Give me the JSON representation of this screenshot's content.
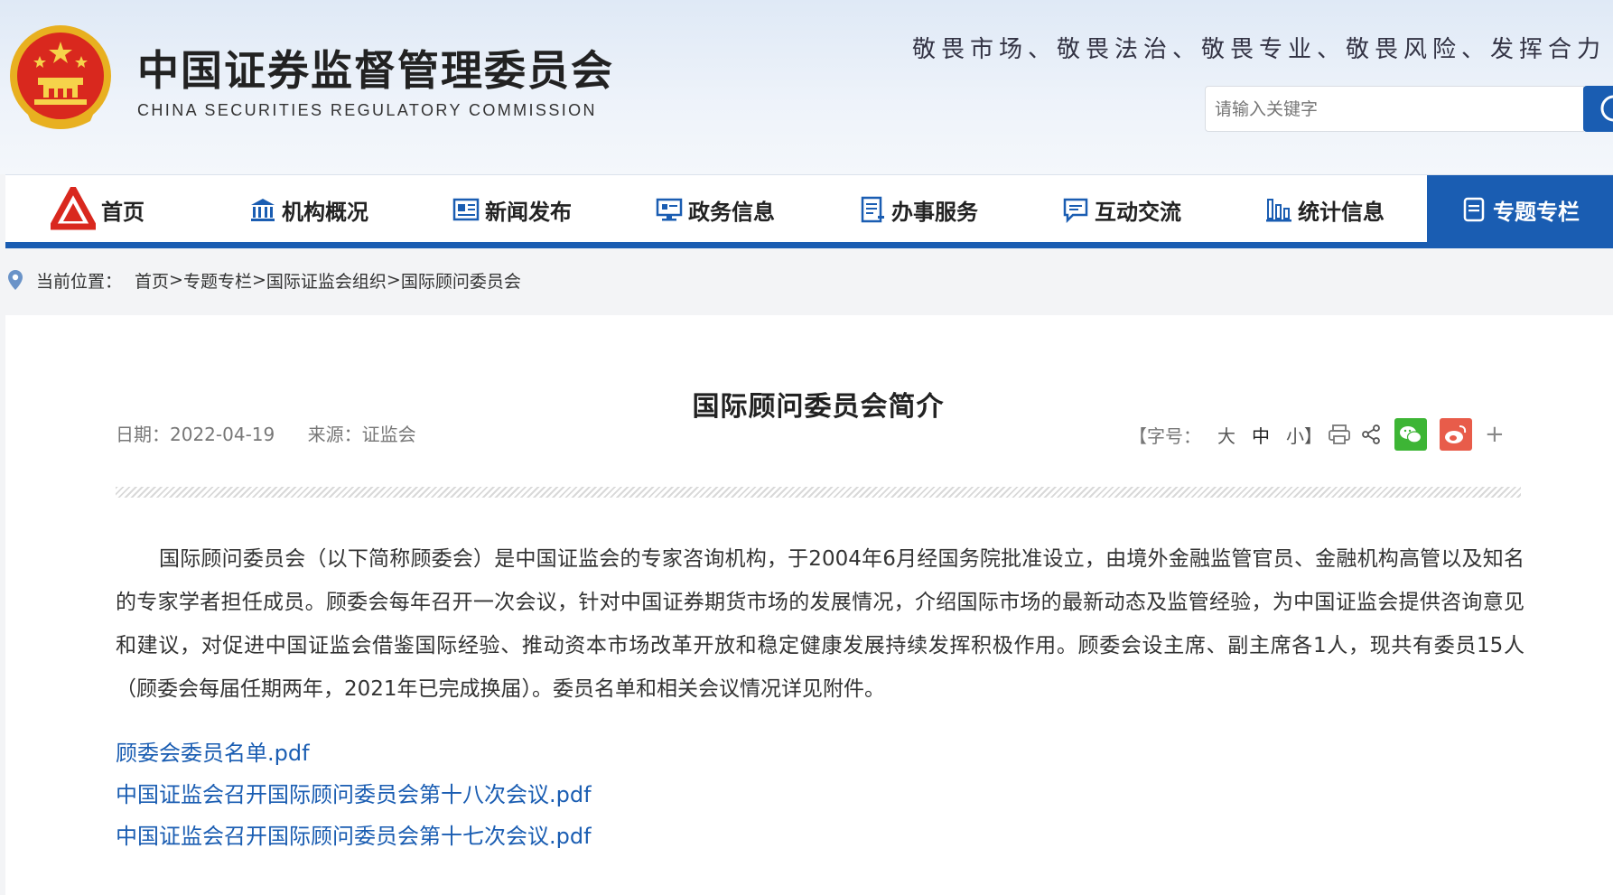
{
  "header": {
    "site_title": "中国证券监督管理委员会",
    "site_subtitle": "CHINA SECURITIES REGULATORY COMMISSION",
    "slogan": "敬畏市场、敬畏法治、敬畏专业、敬畏风险、发挥合力",
    "search": {
      "placeholder": "请输入关键字"
    }
  },
  "nav": {
    "items": [
      {
        "label": "首页",
        "icon": "csrc-logo-icon"
      },
      {
        "label": "机构概况",
        "icon": "building-icon"
      },
      {
        "label": "新闻发布",
        "icon": "news-icon"
      },
      {
        "label": "政务信息",
        "icon": "monitor-icon"
      },
      {
        "label": "办事服务",
        "icon": "document-list-icon"
      },
      {
        "label": "互动交流",
        "icon": "chat-icon"
      },
      {
        "label": "统计信息",
        "icon": "bar-chart-icon"
      },
      {
        "label": "专题专栏",
        "icon": "topic-icon",
        "active": true
      }
    ],
    "active_color": "#1a5db2"
  },
  "breadcrumb": {
    "prefix": "当前位置：",
    "items": [
      "首页",
      "专题专栏",
      "国际证监会组织",
      "国际顾问委员会"
    ],
    "separator": ">"
  },
  "article": {
    "title": "国际顾问委员会简介",
    "date": "日期：2022-04-19",
    "source": "来源：证监会",
    "font_size": {
      "label": "【字号：",
      "large": "大",
      "medium": "中",
      "small": "小】"
    },
    "body": "国际顾问委员会（以下简称顾委会）是中国证监会的专家咨询机构，于2004年6月经国务院批准设立，由境外金融监管官员、金融机构高管以及知名的专家学者担任成员。顾委会每年召开一次会议，针对中国证券期货市场的发展情况，介绍国际市场的最新动态及监管经验，为中国证监会提供咨询意见和建议，对促进中国证监会借鉴国际经验、推动资本市场改革开放和稳定健康发展持续发挥积极作用。顾委会设主席、副主席各1人，现共有委员15人（顾委会每届任期两年，2021年已完成换届）。委员名单和相关会议情况详见附件。",
    "attachments": [
      "顾委会委员名单.pdf",
      "中国证监会召开国际顾问委员会第十八次会议.pdf",
      "中国证监会召开国际顾问委员会第十七次会议.pdf"
    ],
    "share_plus": "+"
  }
}
